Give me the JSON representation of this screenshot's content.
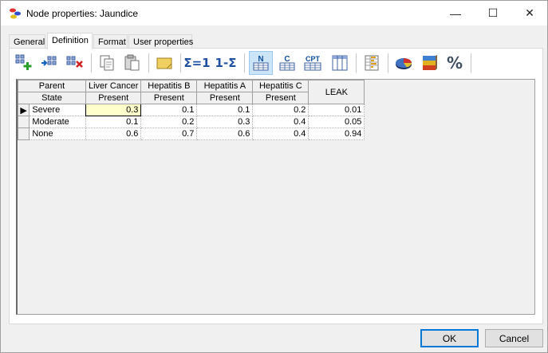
{
  "window": {
    "title": "Node properties: Jaundice",
    "minimize_glyph": "—",
    "maximize_glyph": "☐",
    "close_glyph": "✕"
  },
  "tabs": [
    {
      "label": "General"
    },
    {
      "label": "Definition"
    },
    {
      "label": "Format"
    },
    {
      "label": "User properties"
    }
  ],
  "toolbar": {
    "sum_to_one": "Σ=1",
    "one_minus_sum": "1-Σ",
    "n_label": "N",
    "c_label": "C",
    "cpt_label": "CPT",
    "percent_label": "%"
  },
  "table": {
    "parent_label": "Parent",
    "state_label": "State",
    "columns": [
      {
        "parent": "Liver Cancer",
        "state": "Present"
      },
      {
        "parent": "Hepatitis B",
        "state": "Present"
      },
      {
        "parent": "Hepatitis A",
        "state": "Present"
      },
      {
        "parent": "Hepatitis C",
        "state": "Present"
      }
    ],
    "leak_label": "LEAK",
    "rows": [
      {
        "state": "Severe",
        "values": [
          "0.3",
          "0.1",
          "0.1",
          "0.2"
        ],
        "leak": "0.01"
      },
      {
        "state": "Moderate",
        "values": [
          "0.1",
          "0.2",
          "0.3",
          "0.4"
        ],
        "leak": "0.05"
      },
      {
        "state": "None",
        "values": [
          "0.6",
          "0.7",
          "0.6",
          "0.4"
        ],
        "leak": "0.94"
      }
    ],
    "current_row_marker": "▶"
  },
  "footer": {
    "ok_label": "OK",
    "cancel_label": "Cancel"
  }
}
